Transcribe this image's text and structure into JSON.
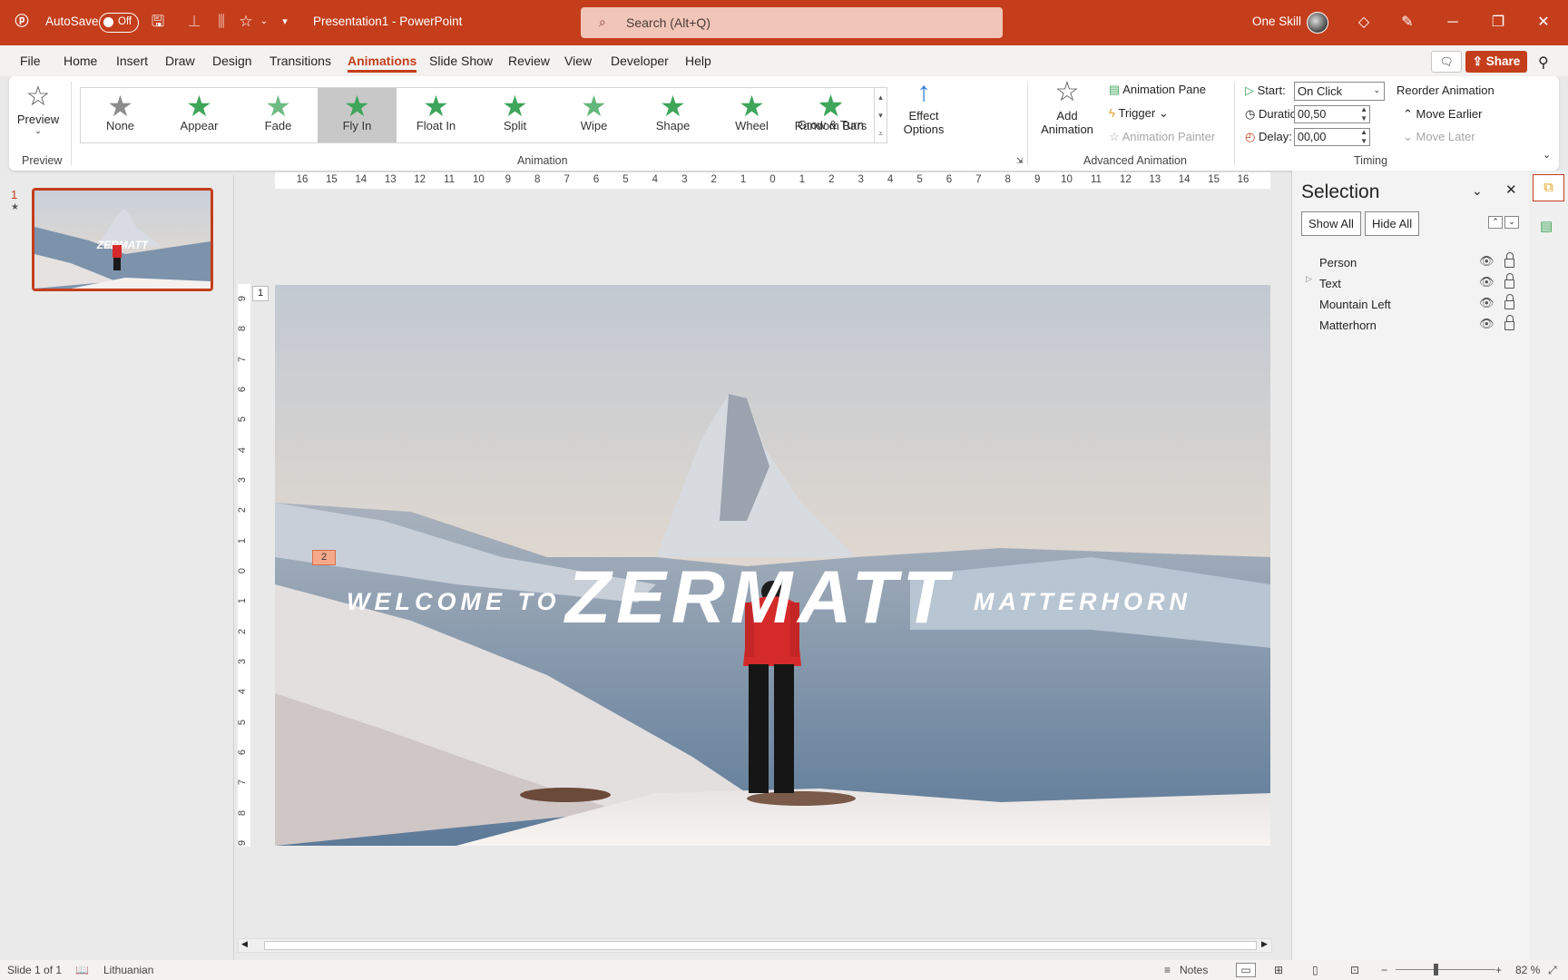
{
  "titlebar": {
    "autosave_label": "AutoSave",
    "autosave_state": "Off",
    "doc_title": "Presentation1  -  PowerPoint",
    "search_placeholder": "Search (Alt+Q)",
    "user_name": "One Skill"
  },
  "menu": {
    "tabs": [
      "File",
      "Home",
      "Insert",
      "Draw",
      "Design",
      "Transitions",
      "Animations",
      "Slide Show",
      "Review",
      "View",
      "Developer",
      "Help"
    ],
    "active": "Animations",
    "share_label": "Share"
  },
  "ribbon": {
    "preview": {
      "button": "Preview",
      "group": "Preview"
    },
    "animations": [
      "None",
      "Appear",
      "Fade",
      "Fly In",
      "Float In",
      "Split",
      "Wipe",
      "Shape",
      "Wheel",
      "Random Bars",
      "Grow & Turn"
    ],
    "selected_animation": "Fly In",
    "effect_options": {
      "line1": "Effect",
      "line2": "Options"
    },
    "animation_group": "Animation",
    "add_animation": {
      "line1": "Add",
      "line2": "Animation"
    },
    "animation_pane": "Animation Pane",
    "trigger": "Trigger",
    "animation_painter": "Animation Painter",
    "advanced_group": "Advanced Animation",
    "start_label": "Start:",
    "start_value": "On Click",
    "duration_label": "Duration:",
    "duration_value": "00,50",
    "delay_label": "Delay:",
    "delay_value": "00,00",
    "timing_group": "Timing",
    "reorder_label": "Reorder Animation",
    "move_earlier": "Move Earlier",
    "move_later": "Move Later"
  },
  "thumbnails": {
    "number": "1"
  },
  "ruler": {
    "top": [
      "16",
      "15",
      "14",
      "13",
      "12",
      "11",
      "10",
      "9",
      "8",
      "7",
      "6",
      "5",
      "4",
      "3",
      "2",
      "1",
      "0",
      "1",
      "2",
      "3",
      "4",
      "5",
      "6",
      "7",
      "8",
      "9",
      "10",
      "11",
      "12",
      "13",
      "14",
      "15",
      "16"
    ],
    "left": [
      "9",
      "8",
      "7",
      "6",
      "5",
      "4",
      "3",
      "2",
      "1",
      "0",
      "1",
      "2",
      "3",
      "4",
      "5",
      "6",
      "7",
      "8",
      "9"
    ]
  },
  "slide": {
    "welcome": "WELCOME TO",
    "title": "ZERMATT",
    "subtitle": "MATTERHORN",
    "placeholder_number": "1",
    "anim_tag": "2"
  },
  "selection_pane": {
    "title": "Selection",
    "show_all": "Show All",
    "hide_all": "Hide All",
    "items": [
      "Person",
      "Text",
      "Mountain Left",
      "Matterhorn"
    ]
  },
  "status": {
    "slide_info": "Slide 1 of 1",
    "language": "Lithuanian",
    "notes": "Notes",
    "zoom": "82 %"
  }
}
